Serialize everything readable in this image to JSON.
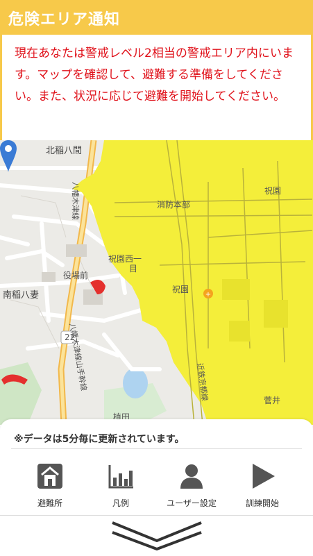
{
  "banner": {
    "title": "危険エリア通知",
    "color": "#f7c94a"
  },
  "alert": {
    "text": "現在あなたは警戒レベル2相当の警戒エリア内にいます。マップを確認して、避難する準備をしてください。また、状況に応じて避難を開始してください。",
    "color": "#e0121b"
  },
  "map": {
    "labels": {
      "kita_inaba": "北稲八間",
      "shobo": "消防本部",
      "hoso": "祝園",
      "hoso_nishi": "祝園西一",
      "chome": "目",
      "yakubamae": "役場前",
      "hoso_station": "祝園",
      "minami_inaba": "南稲八妻",
      "route": "22",
      "uetsu": "植田",
      "sugai": "菅井",
      "road_a": "八幡木津線",
      "road_b": "八幡木津線山手幹線",
      "rail": "近鉄京都線"
    },
    "warning_area_color": "#f4ee3a",
    "pin_color": "#3a7bd5"
  },
  "sheet": {
    "note": "※データは5分毎に更新されています。",
    "menu": [
      {
        "icon": "shelter-icon",
        "label": "避難所"
      },
      {
        "icon": "legend-chart-icon",
        "label": "凡例"
      },
      {
        "icon": "user-icon",
        "label": "ユーザー設定"
      },
      {
        "icon": "play-icon",
        "label": "訓練開始"
      }
    ]
  }
}
